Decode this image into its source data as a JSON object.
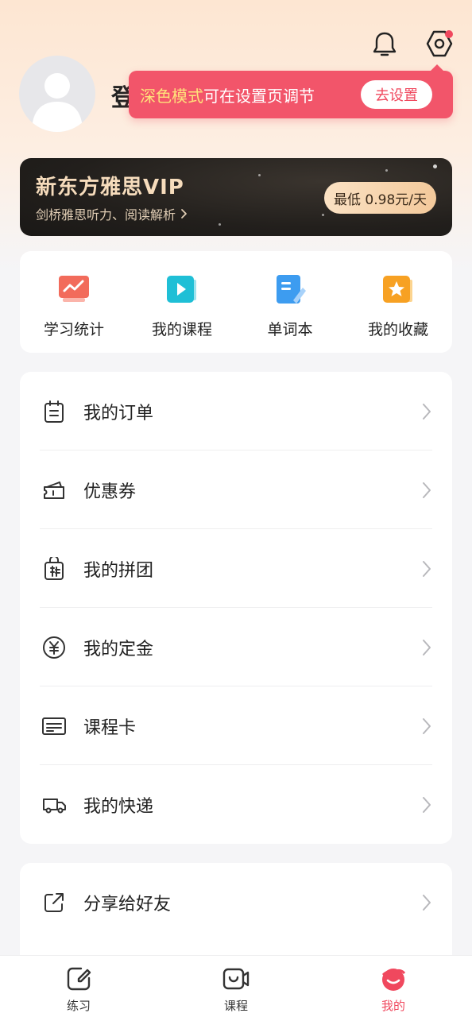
{
  "header": {
    "login_prompt": "登",
    "icons": {
      "bell": "bell-icon",
      "settings": "settings-icon"
    }
  },
  "tooltip": {
    "highlight": "深色模式",
    "text": "可在设置页调节",
    "button": "去设置"
  },
  "vip_banner": {
    "title": "新东方雅思VIP",
    "subtitle": "剑桥雅思听力、阅读解析",
    "price": "最低 0.98元/天"
  },
  "shortcuts": [
    {
      "label": "学习统计",
      "icon": "stats-icon",
      "color": "#f26b5b"
    },
    {
      "label": "我的课程",
      "icon": "course-video-icon",
      "color": "#1fbfd6"
    },
    {
      "label": "单词本",
      "icon": "notebook-icon",
      "color": "#3d9cf0"
    },
    {
      "label": "我的收藏",
      "icon": "favorite-star-icon",
      "color": "#f7a123"
    }
  ],
  "menu": [
    {
      "label": "我的订单",
      "icon": "order-icon"
    },
    {
      "label": "优惠券",
      "icon": "coupon-icon"
    },
    {
      "label": "我的拼团",
      "icon": "group-buy-icon"
    },
    {
      "label": "我的定金",
      "icon": "deposit-icon"
    },
    {
      "label": "课程卡",
      "icon": "course-card-icon"
    },
    {
      "label": "我的快递",
      "icon": "delivery-icon"
    }
  ],
  "share": {
    "label": "分享给好友",
    "icon": "share-icon"
  },
  "tabbar": [
    {
      "label": "练习",
      "icon": "practice-icon",
      "active": false
    },
    {
      "label": "课程",
      "icon": "course-icon",
      "active": false
    },
    {
      "label": "我的",
      "icon": "mine-icon",
      "active": true
    }
  ],
  "colors": {
    "accent": "#f0485e",
    "tooltip_bg": "#f2556a",
    "vip_gold": "#f6dcbc"
  }
}
